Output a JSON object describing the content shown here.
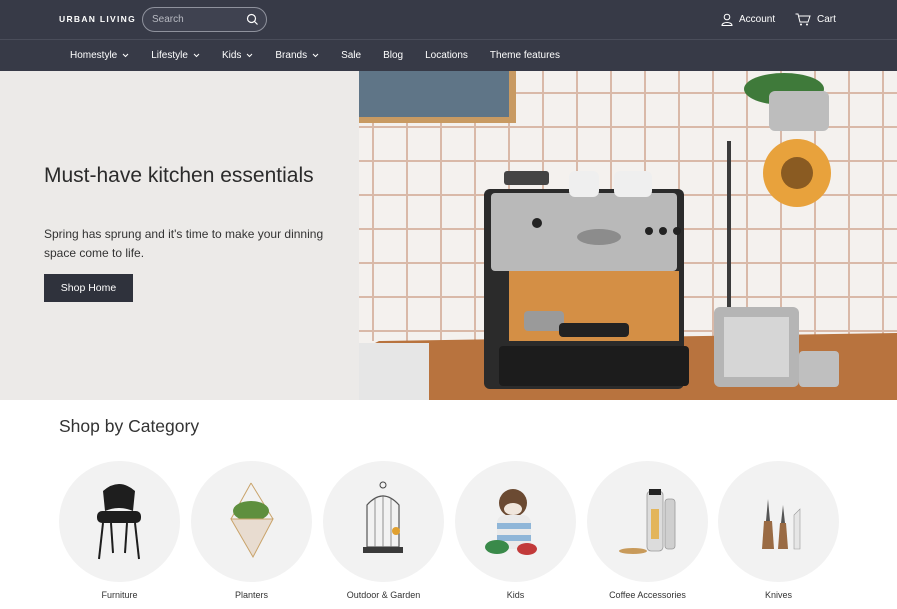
{
  "header": {
    "logo": "URBAN LIVING",
    "search_placeholder": "Search",
    "account_label": "Account",
    "cart_label": "Cart"
  },
  "nav": {
    "items": [
      {
        "label": "Homestyle",
        "dropdown": true
      },
      {
        "label": "Lifestyle",
        "dropdown": true
      },
      {
        "label": "Kids",
        "dropdown": true
      },
      {
        "label": "Brands",
        "dropdown": true
      },
      {
        "label": "Sale",
        "dropdown": false
      },
      {
        "label": "Blog",
        "dropdown": false
      },
      {
        "label": "Locations",
        "dropdown": false
      },
      {
        "label": "Theme features",
        "dropdown": false
      }
    ]
  },
  "hero": {
    "title": "Must-have kitchen essentials",
    "subtitle": "Spring has sprung and it's time to make your dinning space come to life.",
    "button_label": "Shop Home"
  },
  "categories": {
    "heading": "Shop by Category",
    "items": [
      {
        "label": "Furniture",
        "icon": "chair-icon"
      },
      {
        "label": "Planters",
        "icon": "planter-icon"
      },
      {
        "label": "Outdoor & Garden",
        "icon": "birdcage-icon"
      },
      {
        "label": "Kids",
        "icon": "sock-monkey-icon"
      },
      {
        "label": "Coffee Accessories",
        "icon": "coffee-grinder-icon"
      },
      {
        "label": "Knives",
        "icon": "knives-icon"
      }
    ]
  },
  "colors": {
    "header_bg": "#373a47",
    "hero_bg": "#eceae8",
    "button_bg": "#2f323c",
    "circle_bg": "#f2f2f2"
  }
}
